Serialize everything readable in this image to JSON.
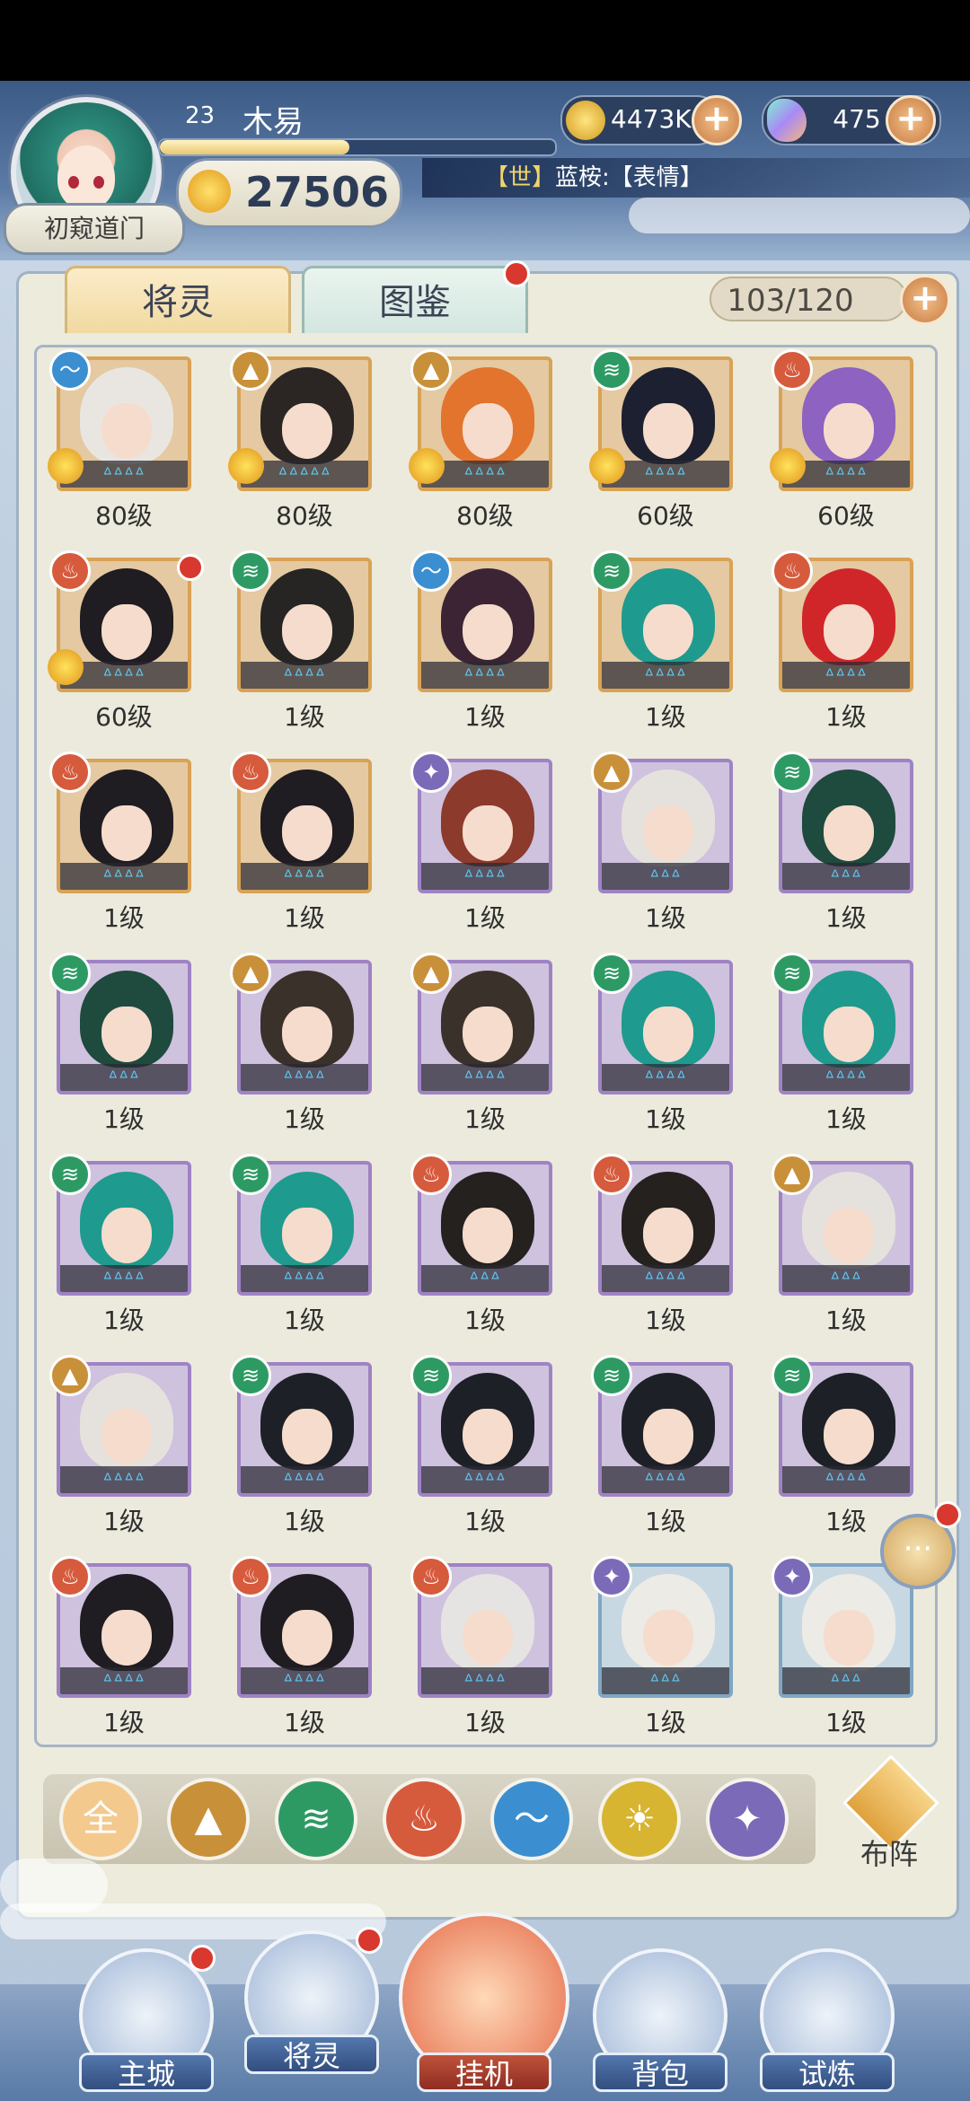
{
  "player": {
    "level": "23",
    "name": "木易",
    "power": "27506",
    "rank": "初窥道门",
    "exp_fraction": 0.48
  },
  "currency": {
    "coins": "4473K",
    "gems": "475",
    "plus": "+"
  },
  "chat": {
    "channel": "【世】",
    "text": "蓝桉:【表情】"
  },
  "tabs": [
    {
      "label": "将灵"
    },
    {
      "label": "图鉴"
    }
  ],
  "capacity": "103/120",
  "colors": {
    "fire": "#d65a3c",
    "wind": "#2d9a64",
    "water": "#3b8fd0",
    "earth": "#c9903a",
    "light": "#d8b531",
    "dark": "#7a6ab8"
  },
  "cards": [
    {
      "element": "water",
      "frame": "gold",
      "level": "80级",
      "crown": true,
      "hair": "#e9e6e2",
      "stars": "ᐞᐞᐞᐞ"
    },
    {
      "element": "earth",
      "frame": "gold",
      "level": "80级",
      "crown": true,
      "hair": "#2b2624",
      "stars": "ᐞᐞᐞᐞᐞ"
    },
    {
      "element": "earth",
      "frame": "gold",
      "level": "80级",
      "crown": true,
      "hair": "#e2742e",
      "stars": "ᐞᐞᐞᐞ"
    },
    {
      "element": "wind",
      "frame": "gold",
      "level": "60级",
      "crown": true,
      "hair": "#1d2030",
      "stars": "ᐞᐞᐞᐞ"
    },
    {
      "element": "fire",
      "frame": "gold",
      "level": "60级",
      "crown": true,
      "hair": "#8d62c0",
      "stars": "ᐞᐞᐞᐞ"
    },
    {
      "element": "fire",
      "frame": "gold",
      "level": "60级",
      "crown": true,
      "hair": "#1f1c22",
      "stars": "ᐞᐞᐞᐞ",
      "badge": true
    },
    {
      "element": "wind",
      "frame": "gold",
      "level": "1级",
      "crown": false,
      "hair": "#262523",
      "stars": "ᐞᐞᐞᐞ"
    },
    {
      "element": "water",
      "frame": "gold",
      "level": "1级",
      "crown": false,
      "hair": "#3c2434",
      "stars": "ᐞᐞᐞᐞ"
    },
    {
      "element": "wind",
      "frame": "gold",
      "level": "1级",
      "crown": false,
      "hair": "#1f9a8e",
      "stars": "ᐞᐞᐞᐞ"
    },
    {
      "element": "fire",
      "frame": "gold",
      "level": "1级",
      "crown": false,
      "hair": "#d0262a",
      "stars": "ᐞᐞᐞᐞ"
    },
    {
      "element": "fire",
      "frame": "gold",
      "level": "1级",
      "crown": false,
      "hair": "#1f1c22",
      "stars": "ᐞᐞᐞᐞ"
    },
    {
      "element": "fire",
      "frame": "gold",
      "level": "1级",
      "crown": false,
      "hair": "#1f1c22",
      "stars": "ᐞᐞᐞᐞ"
    },
    {
      "element": "dark",
      "frame": "purple",
      "level": "1级",
      "crown": false,
      "hair": "#8b3a2c",
      "stars": "ᐞᐞᐞᐞ"
    },
    {
      "element": "earth",
      "frame": "purple",
      "level": "1级",
      "crown": false,
      "hair": "#e5e2de",
      "stars": "ᐞᐞᐞ"
    },
    {
      "element": "wind",
      "frame": "purple",
      "level": "1级",
      "crown": false,
      "hair": "#1f4a3e",
      "stars": "ᐞᐞᐞ"
    },
    {
      "element": "wind",
      "frame": "purple",
      "level": "1级",
      "crown": false,
      "hair": "#1f4a3e",
      "stars": "ᐞᐞᐞ"
    },
    {
      "element": "earth",
      "frame": "purple",
      "level": "1级",
      "crown": false,
      "hair": "#3a312b",
      "stars": "ᐞᐞᐞᐞ"
    },
    {
      "element": "earth",
      "frame": "purple",
      "level": "1级",
      "crown": false,
      "hair": "#3a312b",
      "stars": "ᐞᐞᐞᐞ"
    },
    {
      "element": "wind",
      "frame": "purple",
      "level": "1级",
      "crown": false,
      "hair": "#1f9a8e",
      "stars": "ᐞᐞᐞᐞ"
    },
    {
      "element": "wind",
      "frame": "purple",
      "level": "1级",
      "crown": false,
      "hair": "#1f9a8e",
      "stars": "ᐞᐞᐞᐞ"
    },
    {
      "element": "wind",
      "frame": "purple",
      "level": "1级",
      "crown": false,
      "hair": "#1f9a8e",
      "stars": "ᐞᐞᐞᐞ"
    },
    {
      "element": "wind",
      "frame": "purple",
      "level": "1级",
      "crown": false,
      "hair": "#1f9a8e",
      "stars": "ᐞᐞᐞᐞ"
    },
    {
      "element": "fire",
      "frame": "purple",
      "level": "1级",
      "crown": false,
      "hair": "#24211f",
      "stars": "ᐞᐞᐞ"
    },
    {
      "element": "fire",
      "frame": "purple",
      "level": "1级",
      "crown": false,
      "hair": "#24211f",
      "stars": "ᐞᐞᐞᐞ"
    },
    {
      "element": "earth",
      "frame": "purple",
      "level": "1级",
      "crown": false,
      "hair": "#e5e2de",
      "stars": "ᐞᐞᐞ"
    },
    {
      "element": "earth",
      "frame": "purple",
      "level": "1级",
      "crown": false,
      "hair": "#e5e2de",
      "stars": "ᐞᐞᐞᐞ"
    },
    {
      "element": "wind",
      "frame": "purple",
      "level": "1级",
      "crown": false,
      "hair": "#1d2026",
      "stars": "ᐞᐞᐞᐞ"
    },
    {
      "element": "wind",
      "frame": "purple",
      "level": "1级",
      "crown": false,
      "hair": "#1d2026",
      "stars": "ᐞᐞᐞᐞ"
    },
    {
      "element": "wind",
      "frame": "purple",
      "level": "1级",
      "crown": false,
      "hair": "#1d2026",
      "stars": "ᐞᐞᐞᐞ"
    },
    {
      "element": "wind",
      "frame": "purple",
      "level": "1级",
      "crown": false,
      "hair": "#1d2026",
      "stars": "ᐞᐞᐞᐞ"
    },
    {
      "element": "fire",
      "frame": "purple",
      "level": "1级",
      "crown": false,
      "hair": "#1f1c22",
      "stars": "ᐞᐞᐞᐞ"
    },
    {
      "element": "fire",
      "frame": "purple",
      "level": "1级",
      "crown": false,
      "hair": "#1f1c22",
      "stars": "ᐞᐞᐞᐞ"
    },
    {
      "element": "fire",
      "frame": "purple",
      "level": "1级",
      "crown": false,
      "hair": "#e6e4e2",
      "stars": "ᐞᐞᐞᐞ"
    },
    {
      "element": "dark",
      "frame": "blue",
      "level": "1级",
      "crown": false,
      "hair": "#ecebe6",
      "stars": "ᐞᐞᐞ"
    },
    {
      "element": "dark",
      "frame": "blue",
      "level": "1级",
      "crown": false,
      "hair": "#ecebe6",
      "stars": "ᐞᐞᐞ"
    }
  ],
  "filters": [
    {
      "label": "全",
      "color": "#f3c98e",
      "name": "filter-all"
    },
    {
      "label": "",
      "color": "#c9903a",
      "name": "filter-earth-icon"
    },
    {
      "label": "",
      "color": "#2d9a64",
      "name": "filter-wind-icon"
    },
    {
      "label": "",
      "color": "#d65a3c",
      "name": "filter-fire-icon"
    },
    {
      "label": "",
      "color": "#3b8fd0",
      "name": "filter-water-icon"
    },
    {
      "label": "",
      "color": "#d8b531",
      "name": "filter-light-icon"
    },
    {
      "label": "",
      "color": "#7a6ab8",
      "name": "filter-dark-icon"
    }
  ],
  "deploy_label": "布阵",
  "nav": [
    {
      "label": "主城"
    },
    {
      "label": "将灵"
    },
    {
      "label": "挂机"
    },
    {
      "label": "背包"
    },
    {
      "label": "试炼"
    }
  ],
  "side_chat": "···"
}
